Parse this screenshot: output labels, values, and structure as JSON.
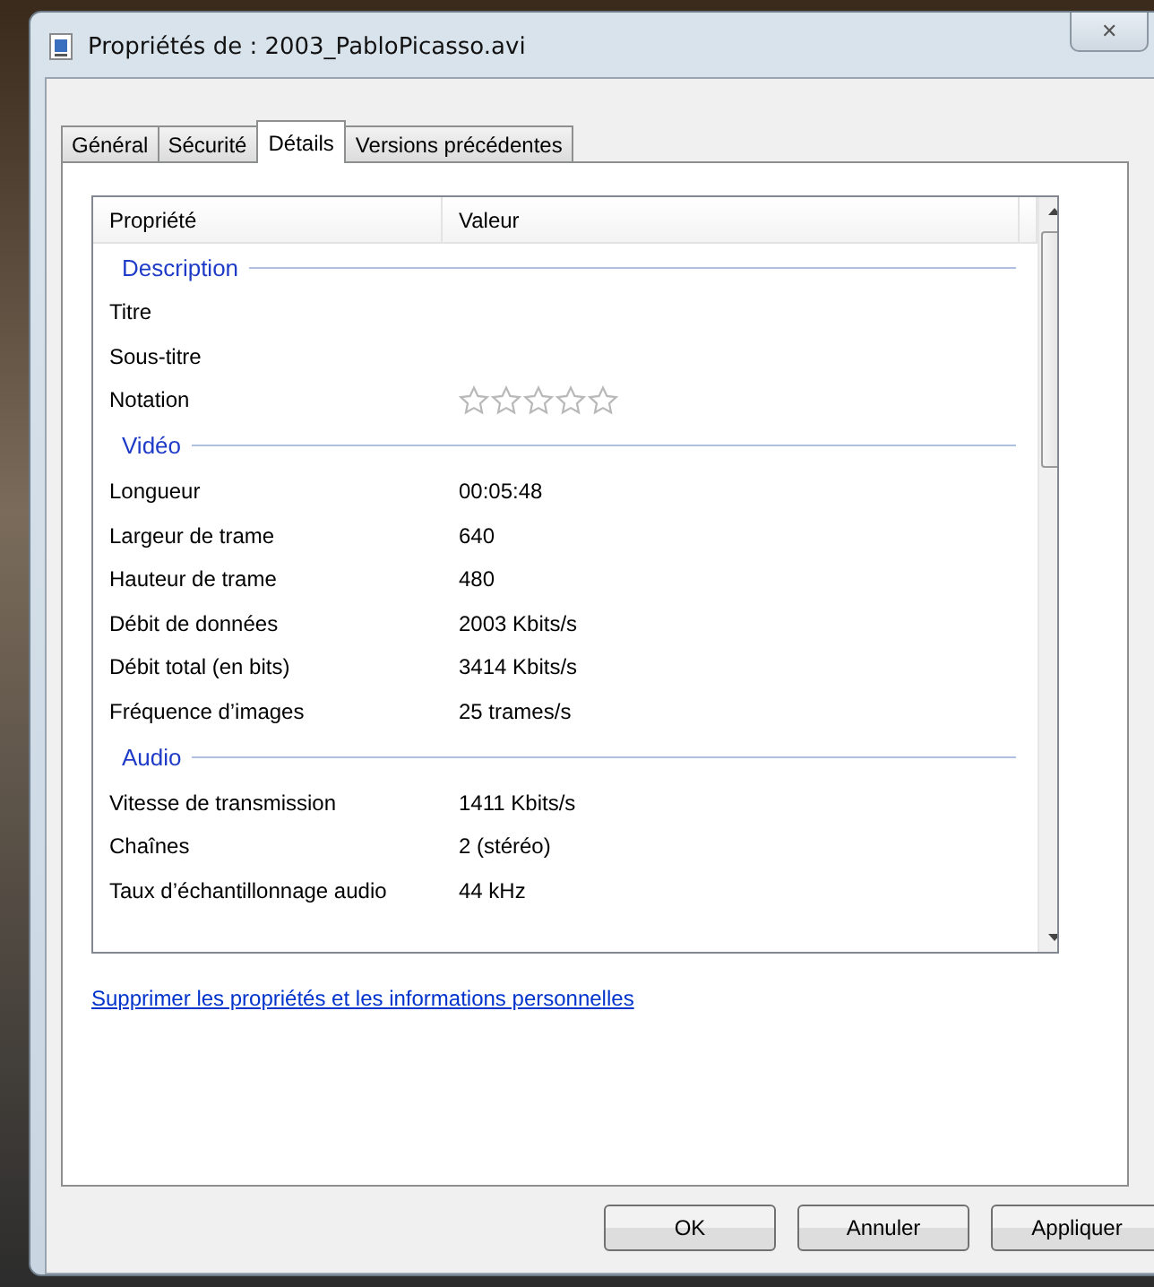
{
  "window": {
    "title": "Propriétés de : 2003_PabloPicasso.avi",
    "close_glyph": "✕"
  },
  "tabs": [
    {
      "label": "Général",
      "selected": false
    },
    {
      "label": "Sécurité",
      "selected": false
    },
    {
      "label": "Détails",
      "selected": true
    },
    {
      "label": "Versions précédentes",
      "selected": false
    }
  ],
  "table": {
    "columns": [
      "Propriété",
      "Valeur"
    ],
    "rows": [
      {
        "kind": "group",
        "label": "Description"
      },
      {
        "kind": "row",
        "property": "Titre",
        "value": ""
      },
      {
        "kind": "row",
        "property": "Sous-titre",
        "value": ""
      },
      {
        "kind": "rating",
        "property": "Notation",
        "stars": 0
      },
      {
        "kind": "group",
        "label": "Vidéo"
      },
      {
        "kind": "row",
        "property": "Longueur",
        "value": "00:05:48"
      },
      {
        "kind": "row",
        "property": "Largeur de trame",
        "value": "640"
      },
      {
        "kind": "row",
        "property": "Hauteur de trame",
        "value": "480"
      },
      {
        "kind": "row",
        "property": "Débit de données",
        "value": "2003 Kbits/s"
      },
      {
        "kind": "row",
        "property": "Débit total (en bits)",
        "value": "3414 Kbits/s"
      },
      {
        "kind": "row",
        "property": "Fréquence d’images",
        "value": "25 trames/s"
      },
      {
        "kind": "group",
        "label": "Audio"
      },
      {
        "kind": "row",
        "property": "Vitesse de transmission",
        "value": "1411 Kbits/s"
      },
      {
        "kind": "row",
        "property": "Chaînes",
        "value": "2 (stéréo)"
      },
      {
        "kind": "row",
        "property": "Taux d’échantillonnage audio",
        "value": "44 kHz"
      }
    ]
  },
  "link": "Supprimer les propriétés et les informations personnelles",
  "buttons": [
    "OK",
    "Annuler",
    "Appliquer"
  ]
}
